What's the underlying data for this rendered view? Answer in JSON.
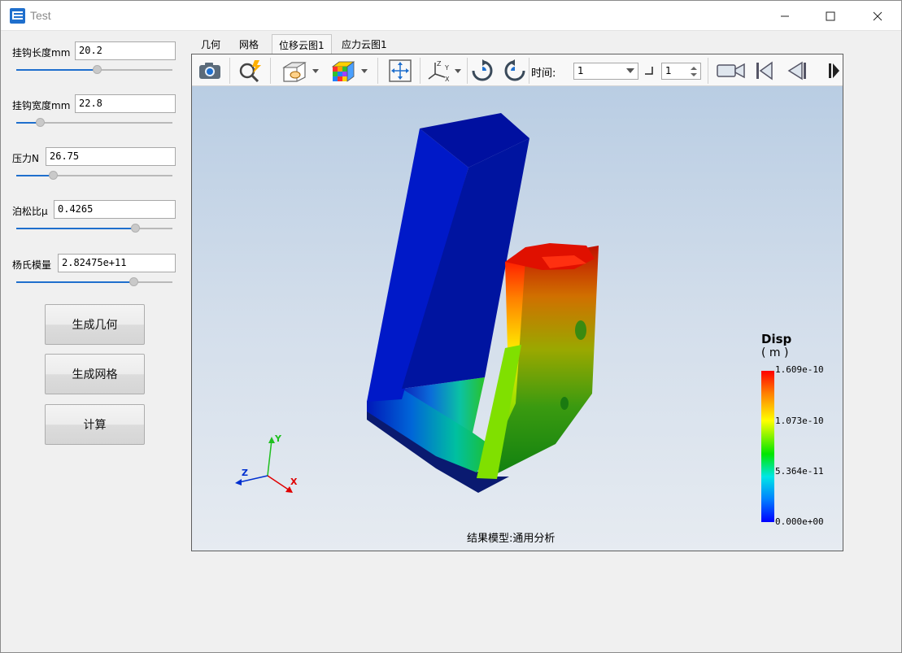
{
  "window": {
    "title": "Test",
    "colors": {
      "accent": "#1f6fcd",
      "titlebar": "#ffffff",
      "background": "#f0f0f0"
    }
  },
  "params": [
    {
      "label": "挂钩长度mm",
      "value": "20.2",
      "slider_fraction": 0.52
    },
    {
      "label": "挂钩宽度mm",
      "value": "22.8",
      "slider_fraction": 0.13
    },
    {
      "label": "压力N",
      "value": "26.75",
      "slider_fraction": 0.22
    },
    {
      "label": "泊松比μ",
      "value": "0.4265",
      "slider_fraction": 0.78
    },
    {
      "label": "杨氏模量",
      "value": "2.82475e+11",
      "slider_fraction": 0.77
    }
  ],
  "buttons": {
    "generate_geometry": "生成几何",
    "generate_mesh": "生成网格",
    "compute": "计算"
  },
  "tabs": [
    {
      "label": "几何",
      "active": false
    },
    {
      "label": "网格",
      "active": false
    },
    {
      "label": "位移云图1",
      "active": true
    },
    {
      "label": "应力云图1",
      "active": false
    }
  ],
  "toolbar": {
    "time_label": "时间:",
    "time_value": "1",
    "step_value": "1",
    "icons": [
      "camera-icon",
      "quick-zoom-icon",
      "display-mode-icon",
      "color-cube-icon",
      "fit-view-icon",
      "axis-view-icon",
      "rotate-cw-icon",
      "rotate-ccw-icon",
      "video-camera-icon",
      "first-frame-icon",
      "previous-frame-icon",
      "play-icon"
    ]
  },
  "viewer": {
    "legend": {
      "title": "Disp",
      "unit": "( m )",
      "ticks": [
        "1.609e-10",
        "1.073e-10",
        "5.364e-11",
        "0.000e+00"
      ]
    },
    "axes": {
      "x": "X",
      "y": "Y",
      "z": "Z"
    },
    "caption": "结果模型:通用分析"
  }
}
